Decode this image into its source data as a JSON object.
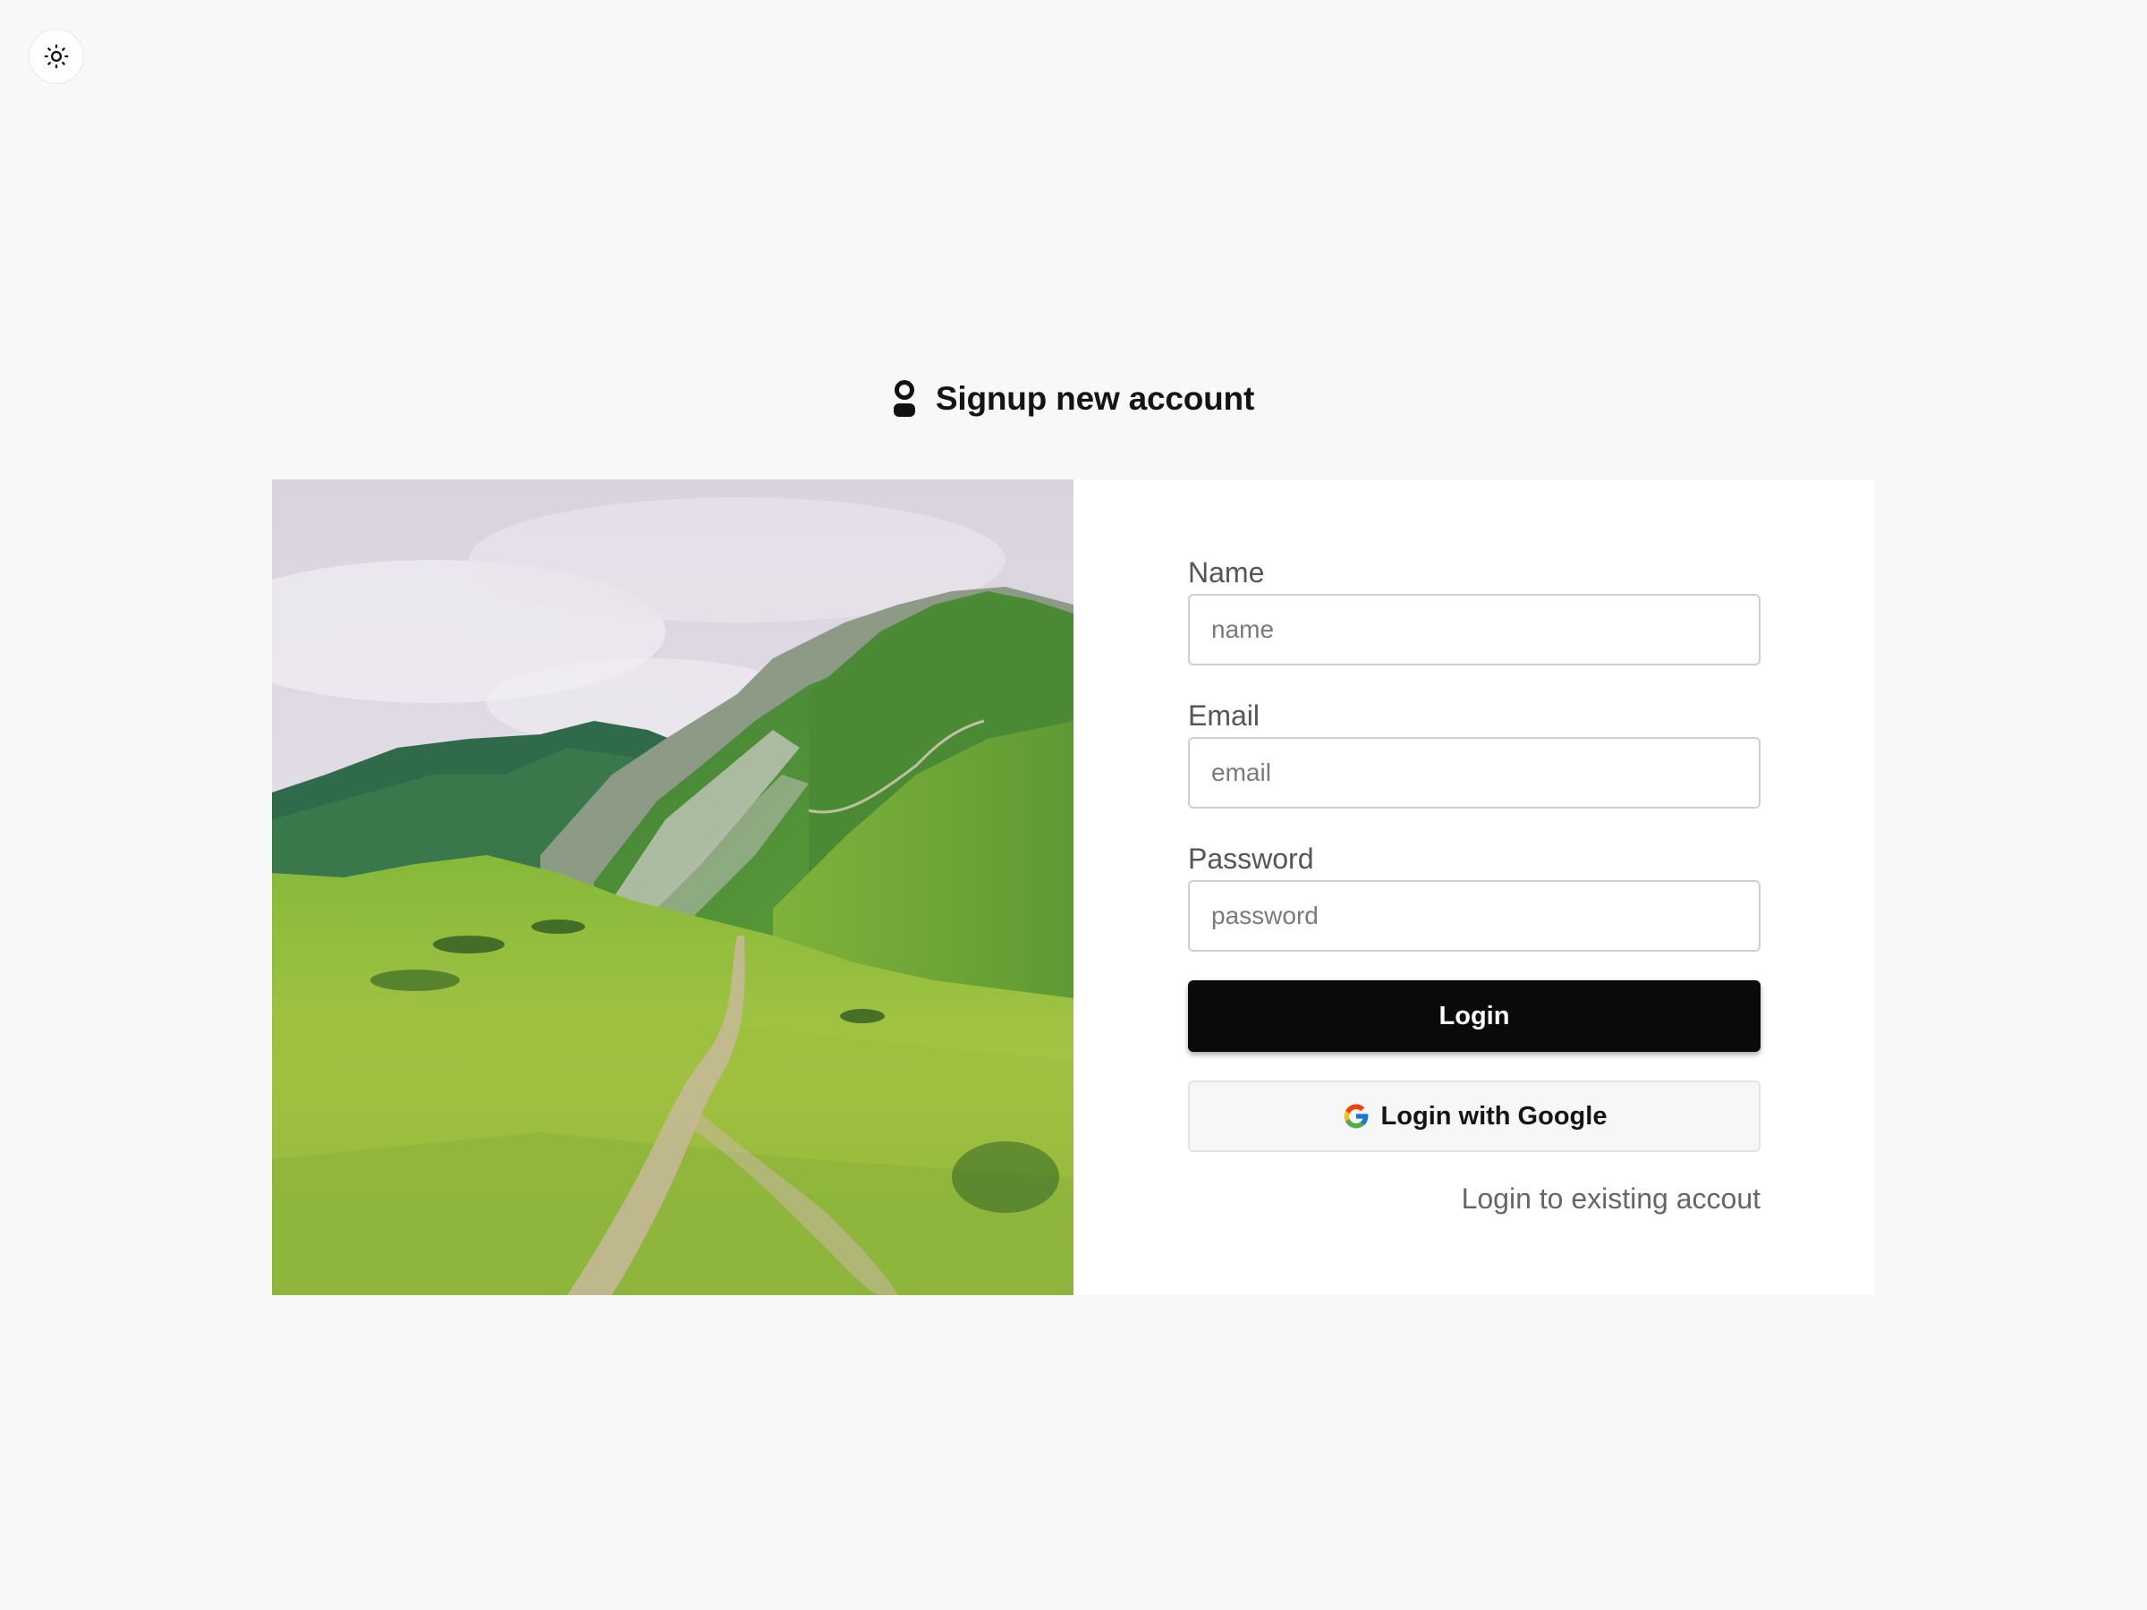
{
  "header": {
    "title": "Signup new account",
    "logo_icon": "user-icon",
    "theme_toggle_icon": "sun-icon"
  },
  "hero_image": {
    "description": "mountain-landscape-photo"
  },
  "form": {
    "name": {
      "label": "Name",
      "placeholder": "name",
      "value": ""
    },
    "email": {
      "label": "Email",
      "placeholder": "email",
      "value": ""
    },
    "password": {
      "label": "Password",
      "placeholder": "password",
      "value": ""
    },
    "login_label": "Login",
    "google_label": "Login with Google",
    "google_icon": "google-icon",
    "existing_account_link": "Login to existing accout"
  },
  "colors": {
    "background": "#f8f8f8",
    "primary_button": "#0a0a0c",
    "card": "#ffffff"
  }
}
